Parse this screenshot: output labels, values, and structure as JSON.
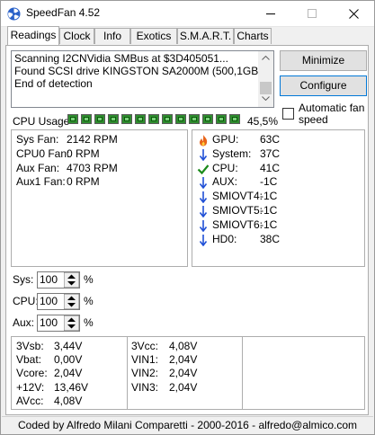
{
  "window": {
    "title": "SpeedFan 4.52",
    "controls": {
      "minimize": "–",
      "maximize": "□",
      "close": "✕"
    }
  },
  "tabs": [
    {
      "label": "Readings",
      "active": true
    },
    {
      "label": "Clock"
    },
    {
      "label": "Info"
    },
    {
      "label": "Exotics"
    },
    {
      "label": "S.M.A.R.T."
    },
    {
      "label": "Charts"
    }
  ],
  "log": {
    "lines": [
      "Scanning I2CNVidia SMBus at $3D405051...",
      "Found SCSI drive KINGSTON SA2000M (500,1GB)",
      "End of detection"
    ]
  },
  "buttons": {
    "minimize": "Minimize",
    "configure": "Configure"
  },
  "auto_fan": {
    "label": "Automatic fan speed",
    "checked": false
  },
  "cpu_usage": {
    "label": "CPU Usage",
    "percent": "45,5%",
    "cells": 13
  },
  "fans": [
    {
      "name": "Sys Fan:",
      "value": "2142 RPM"
    },
    {
      "name": "CPU0 Fan:",
      "value": "0 RPM"
    },
    {
      "name": "Aux Fan:",
      "value": "4703 RPM"
    },
    {
      "name": "Aux1 Fan:",
      "value": "0 RPM"
    }
  ],
  "temps": [
    {
      "name": "GPU:",
      "value": "63C",
      "icon": "flame-icon"
    },
    {
      "name": "System:",
      "value": "37C",
      "icon": "arrow-down-icon"
    },
    {
      "name": "CPU:",
      "value": "41C",
      "icon": "check-icon"
    },
    {
      "name": "AUX:",
      "value": "-1C",
      "icon": "arrow-down-icon"
    },
    {
      "name": "SMIOVT4:",
      "value": "-1C",
      "icon": "arrow-down-icon"
    },
    {
      "name": "SMIOVT5:",
      "value": "-1C",
      "icon": "arrow-down-icon"
    },
    {
      "name": "SMIOVT6:",
      "value": "-1C",
      "icon": "arrow-down-icon"
    },
    {
      "name": "HD0:",
      "value": "38C",
      "icon": "arrow-down-icon"
    }
  ],
  "speeds": [
    {
      "label": "Sys:",
      "value": "100",
      "unit": "%"
    },
    {
      "label": "CPU:",
      "value": "100",
      "unit": "%"
    },
    {
      "label": "Aux:",
      "value": "100",
      "unit": "%"
    }
  ],
  "voltages": {
    "col1": [
      {
        "name": "3Vsb:",
        "value": "3,44V"
      },
      {
        "name": "Vbat:",
        "value": "0,00V"
      },
      {
        "name": "Vcore:",
        "value": "2,04V"
      },
      {
        "name": "+12V:",
        "value": "13,46V"
      },
      {
        "name": "AVcc:",
        "value": "4,08V"
      }
    ],
    "col2": [
      {
        "name": "3Vcc:",
        "value": "4,08V"
      },
      {
        "name": "VIN1:",
        "value": "2,04V"
      },
      {
        "name": "VIN2:",
        "value": "2,04V"
      },
      {
        "name": "VIN3:",
        "value": "2,04V"
      }
    ]
  },
  "status": "Coded by Alfredo Milani Comparetti - 2000-2016 - alfredo@almico.com",
  "colors": {
    "cpu_meter": "#2f8c2f",
    "arrow_blue": "#1f4fd6",
    "check_green": "#1a8a1a",
    "flame": "#e8641a"
  }
}
